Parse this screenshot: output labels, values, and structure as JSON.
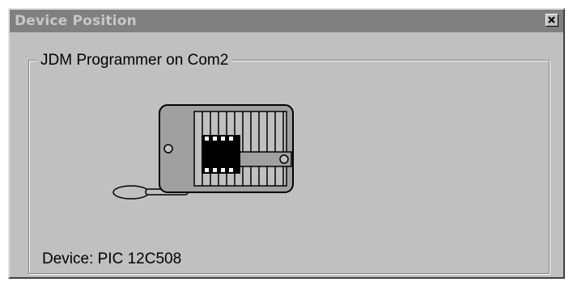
{
  "window": {
    "title": "Device Position",
    "close_icon": "close-x-icon"
  },
  "group": {
    "label": "JDM Programmer on Com2"
  },
  "socket": {
    "icon": "zif-socket-icon",
    "chip_icon": "ic-chip-icon",
    "lever_icon": "socket-lever-icon"
  },
  "device": {
    "label": "Device: PIC 12C508"
  },
  "colors": {
    "window_bg": "#c0c0c0",
    "titlebar_bg": "#808080",
    "title_text": "#c8c8c8",
    "chip": "#000000",
    "socket_base": "#a0a0a0"
  }
}
